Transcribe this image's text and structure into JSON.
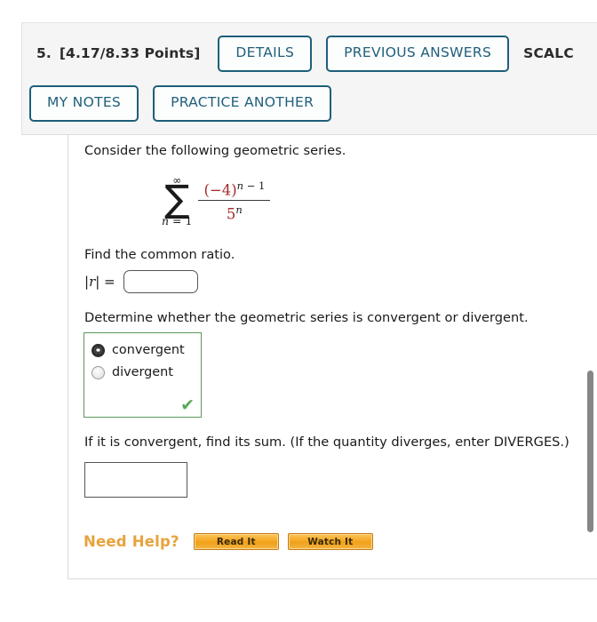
{
  "header": {
    "question_number": "5.",
    "points": "[4.17/8.33 Points]",
    "buttons": [
      {
        "label": "DETAILS",
        "name": "details-button"
      },
      {
        "label": "PREVIOUS ANSWERS",
        "name": "previous-answers-button"
      },
      {
        "label": "MY NOTES",
        "name": "my-notes-button"
      },
      {
        "label": "PRACTICE ANOTHER",
        "name": "practice-another-button"
      }
    ],
    "source_code": "SCALC"
  },
  "question": {
    "prompt_intro": "Consider the following geometric series.",
    "math": {
      "sigma_glyph": "∑",
      "upper_limit": "∞",
      "lower_limit_var": "n",
      "lower_limit_eq": " = 1",
      "numerator_base": "(−4)",
      "numerator_exponent_var": "n",
      "numerator_exponent_rest": " − 1",
      "denominator_base": "5",
      "denominator_exponent": "n",
      "base_color": "#a52a2a"
    },
    "find_ratio_text": "Find the common ratio.",
    "ratio_label_abs_open": "|",
    "ratio_label_var": "r",
    "ratio_label_abs_close": "| =",
    "ratio_input_value": "",
    "ratio_input_placeholder": "",
    "determine_text": "Determine whether the geometric series is convergent or divergent.",
    "choices": [
      {
        "label": "convergent",
        "selected": true
      },
      {
        "label": "divergent",
        "selected": false
      }
    ],
    "choice_feedback_icon": "✔",
    "choice_feedback_color": "#5aa85a",
    "sum_text": "If it is convergent, find its sum. (If the quantity diverges, enter DIVERGES.)",
    "sum_input_value": "",
    "sum_input_placeholder": ""
  },
  "help": {
    "label": "Need Help?",
    "buttons": [
      {
        "label": "Read It",
        "name": "read-it-button"
      },
      {
        "label": "Watch It",
        "name": "watch-it-button"
      }
    ]
  },
  "scrollbar": {
    "orientation": "vertical"
  }
}
